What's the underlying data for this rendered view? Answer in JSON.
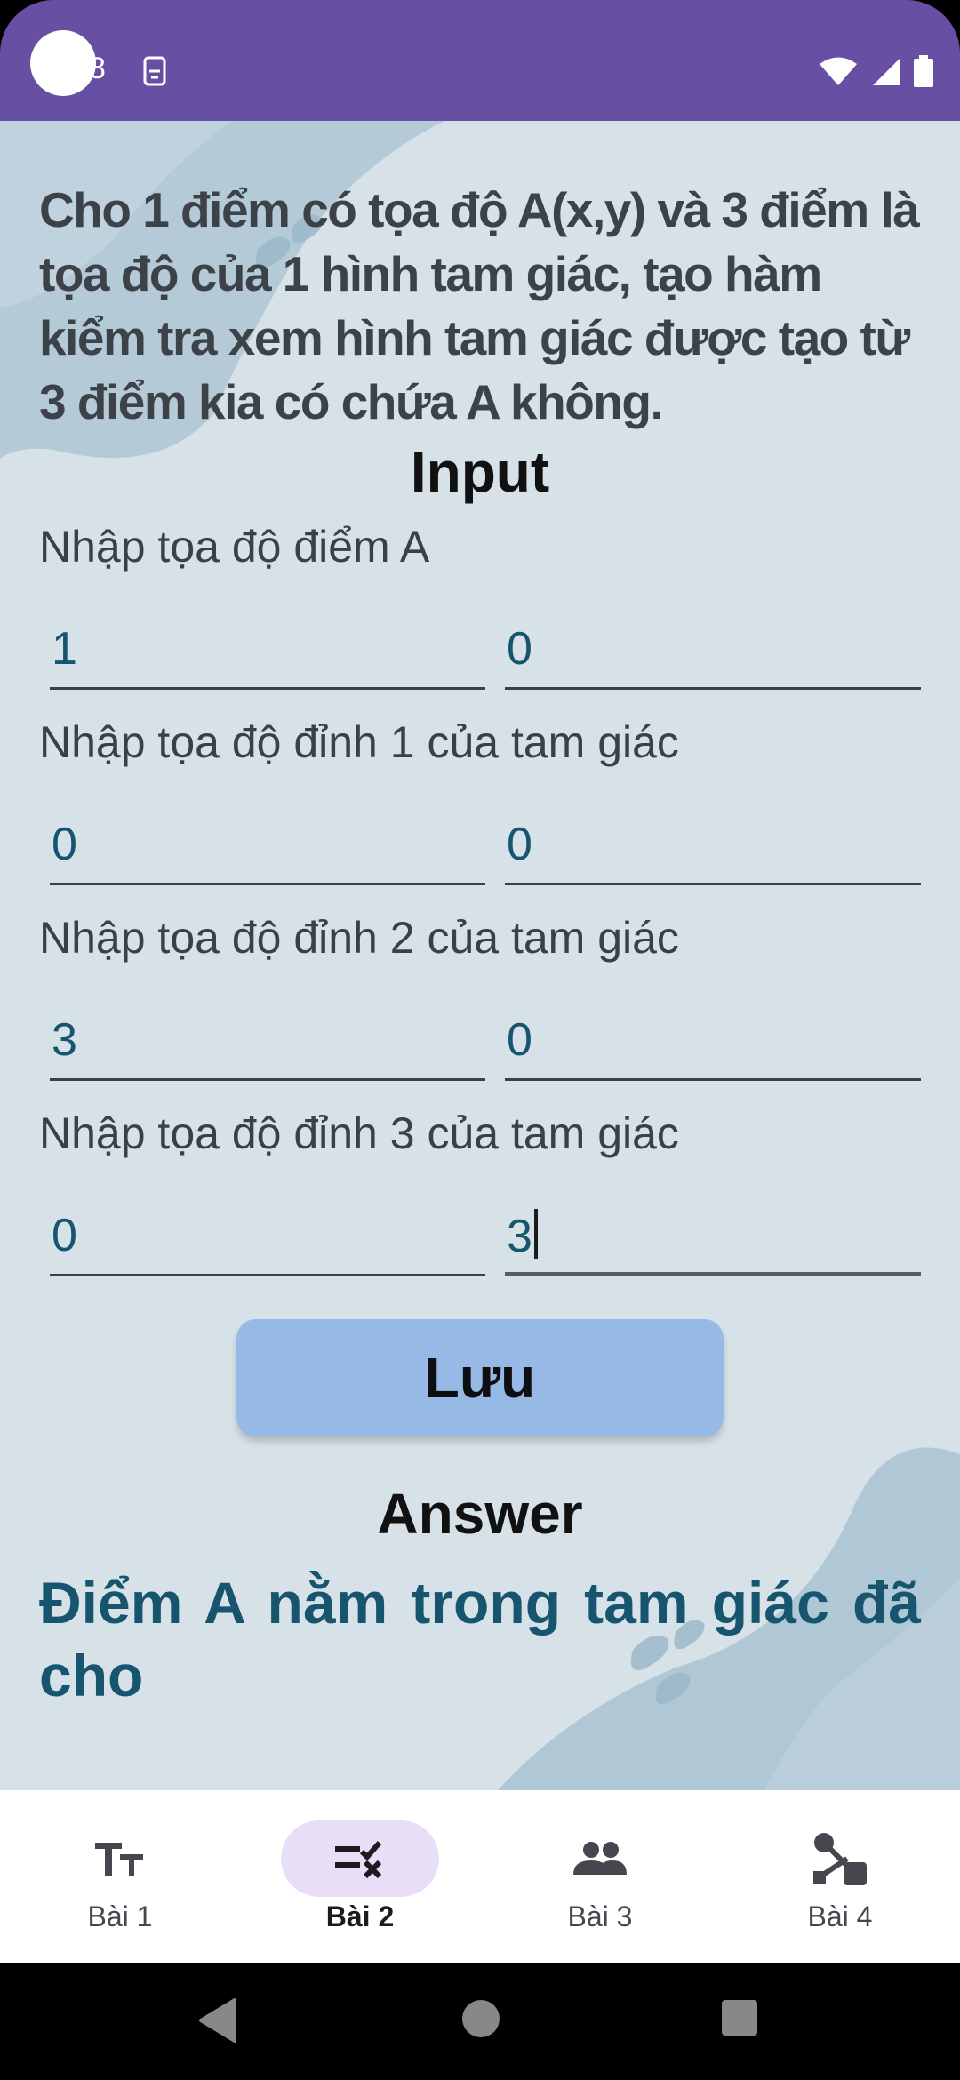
{
  "status_bar": {
    "time": "8",
    "background_color": "#6750A4"
  },
  "problem": {
    "text": "Cho 1 điểm có  tọa độ A(x,y) và 3 điểm là tọa độ của 1 hình tam giác, tạo hàm kiểm tra xem hình tam giác được tạo từ 3 điểm kia có chứa A không."
  },
  "input": {
    "title": "Input",
    "point_a": {
      "label": "Nhập tọa độ điểm A",
      "x": "1",
      "y": "0"
    },
    "vertex_1": {
      "label": "Nhập tọa độ đỉnh 1 của tam giác",
      "x": "0",
      "y": "0"
    },
    "vertex_2": {
      "label": "Nhập tọa độ đỉnh 2 của tam giác",
      "x": "3",
      "y": "0"
    },
    "vertex_3": {
      "label": "Nhập tọa độ đỉnh 3 của tam giác",
      "x": "0",
      "y": "3"
    }
  },
  "save_button": {
    "label": "Lưu",
    "color": "#96B9E6"
  },
  "answer": {
    "title": "Answer",
    "text": "Điểm A nằm trong tam giác đã cho",
    "color": "#17556F"
  },
  "bottom_nav": {
    "items": [
      {
        "label": "Bài 1",
        "icon": "text-fields-icon"
      },
      {
        "label": "Bài 2",
        "icon": "rule-icon",
        "active": true
      },
      {
        "label": "Bài 3",
        "icon": "group-icon"
      },
      {
        "label": "Bài 4",
        "icon": "polyline-icon"
      }
    ],
    "active_pill_color": "#E8DEF8"
  },
  "system_nav": {
    "buttons": [
      "back-icon",
      "home-icon",
      "recents-icon"
    ]
  }
}
